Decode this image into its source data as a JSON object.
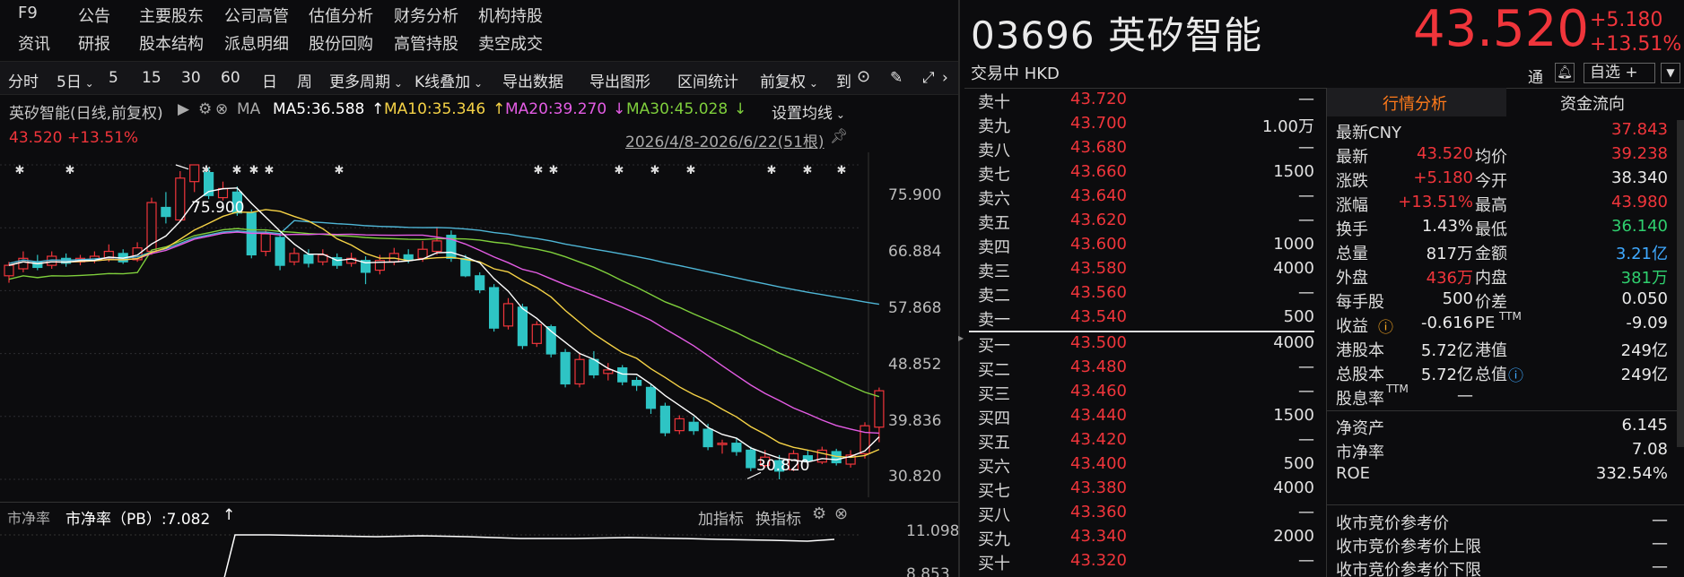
{
  "top_menu": {
    "row1": [
      "F9",
      "公告",
      "主要股东",
      "公司高管",
      "估值分析",
      "财务分析",
      "机构持股"
    ],
    "row2": [
      "资讯",
      "研报",
      "股本结构",
      "派息明细",
      "股份回购",
      "高管持股",
      "卖空成交"
    ]
  },
  "toolbar": {
    "items": [
      "分时",
      "5日",
      "5",
      "15",
      "30",
      "60",
      "日",
      "周",
      "更多周期",
      "K线叠加",
      "导出数据",
      "导出图形",
      "区间统计",
      "前复权",
      "到"
    ],
    "active": "日"
  },
  "ma_row": {
    "title": "英矽智能(日线,前复权)",
    "ma_label": "MA",
    "ma5": "MA5:36.588",
    "ma10": "MA10:35.346",
    "ma20": "MA20:39.270",
    "ma30": "MA30:45.028",
    "settings": "设置均线",
    "price": "43.520",
    "change_pct": "+13.51%",
    "range": "2026/4/8-2026/6/22(51根)"
  },
  "chart": {
    "y_ticks": [
      "75.900",
      "66.884",
      "57.868",
      "48.852",
      "39.836",
      "30.820"
    ],
    "high_label": "75.900",
    "low_label": "30.820",
    "colors": {
      "up": "#f0353b",
      "down": "#2ec4c4",
      "ma5": "#ffffff",
      "ma10": "#f5d246",
      "ma20": "#e45ce4",
      "ma30": "#7fcf3c",
      "ma60": "#4fb6d6"
    }
  },
  "sub_chart": {
    "name": "市净率",
    "label": "市净率（PB）:7.082",
    "add_indicator": "加指标",
    "swap_indicator": "换指标",
    "top_tick": "11.098",
    "bottom_tick": "8.853"
  },
  "quote": {
    "code_name": "03696 英矽智能",
    "status": "交易中 HKD",
    "price": "43.520",
    "change": "+5.180",
    "change_pct": "+13.51%",
    "tong": "通",
    "select": "自选 +"
  },
  "orderbook": {
    "asks": [
      {
        "label": "卖十",
        "price": "43.720",
        "vol": "—"
      },
      {
        "label": "卖九",
        "price": "43.700",
        "vol": "1.00万"
      },
      {
        "label": "卖八",
        "price": "43.680",
        "vol": "—"
      },
      {
        "label": "卖七",
        "price": "43.660",
        "vol": "1500"
      },
      {
        "label": "卖六",
        "price": "43.640",
        "vol": "—"
      },
      {
        "label": "卖五",
        "price": "43.620",
        "vol": "—"
      },
      {
        "label": "卖四",
        "price": "43.600",
        "vol": "1000"
      },
      {
        "label": "卖三",
        "price": "43.580",
        "vol": "4000"
      },
      {
        "label": "卖二",
        "price": "43.560",
        "vol": "—"
      },
      {
        "label": "卖一",
        "price": "43.540",
        "vol": "500"
      }
    ],
    "bids": [
      {
        "label": "买一",
        "price": "43.500",
        "vol": "4000"
      },
      {
        "label": "买二",
        "price": "43.480",
        "vol": "—"
      },
      {
        "label": "买三",
        "price": "43.460",
        "vol": "—"
      },
      {
        "label": "买四",
        "price": "43.440",
        "vol": "1500"
      },
      {
        "label": "买五",
        "price": "43.420",
        "vol": "—"
      },
      {
        "label": "买六",
        "price": "43.400",
        "vol": "500"
      },
      {
        "label": "买七",
        "price": "43.380",
        "vol": "4000"
      },
      {
        "label": "买八",
        "price": "43.360",
        "vol": "—"
      },
      {
        "label": "买九",
        "price": "43.340",
        "vol": "2000"
      },
      {
        "label": "买十",
        "price": "43.320",
        "vol": "—"
      }
    ]
  },
  "stats": {
    "tabs": [
      "行情分析",
      "资金流向"
    ],
    "latest_cny_label": "最新CNY",
    "latest_cny": "37.843",
    "rows": [
      {
        "l1": "最新",
        "v1": "43.520",
        "c1": "red",
        "l2": "均价",
        "v2": "39.238",
        "c2": "red"
      },
      {
        "l1": "涨跌",
        "v1": "+5.180",
        "c1": "red",
        "l2": "今开",
        "v2": "38.340",
        "c2": "white"
      },
      {
        "l1": "涨幅",
        "v1": "+13.51%",
        "c1": "red",
        "l2": "最高",
        "v2": "43.980",
        "c2": "red"
      },
      {
        "l1": "换手",
        "v1": "1.43%",
        "c1": "white",
        "l2": "最低",
        "v2": "36.140",
        "c2": "green"
      },
      {
        "l1": "总量",
        "v1": "817万",
        "c1": "white",
        "l2": "金额",
        "v2": "3.21亿",
        "c2": "cyan"
      },
      {
        "l1": "外盘",
        "v1": "436万",
        "c1": "red",
        "l2": "内盘",
        "v2": "381万",
        "c2": "green"
      },
      {
        "l1": "每手股",
        "v1": "500",
        "c1": "white",
        "l2": "价差",
        "v2": "0.050",
        "c2": "white"
      },
      {
        "l1": "收益",
        "v1": "-0.616",
        "c1": "white",
        "l2": "PE",
        "v2": "-9.09",
        "c2": "white"
      },
      {
        "l1": "港股本",
        "v1": "5.72亿",
        "c1": "white",
        "l2": "港值",
        "v2": "249亿",
        "c2": "white"
      },
      {
        "l1": "总股本",
        "v1": "5.72亿",
        "c1": "white",
        "l2": "总值",
        "v2": "249亿",
        "c2": "white"
      },
      {
        "l1": "股息率",
        "v1": "—",
        "c1": "white",
        "l2": "",
        "v2": "",
        "c2": "white"
      }
    ],
    "pe_sup": "TTM",
    "div_sup": "TTM",
    "extra": [
      {
        "label": "净资产",
        "value": "6.145"
      },
      {
        "label": "市净率",
        "value": "7.08"
      },
      {
        "label": "ROE",
        "value": "332.54%"
      }
    ],
    "auction": [
      {
        "label": "收市竞价参考价",
        "value": "—"
      },
      {
        "label": "收市竞价参考价上限",
        "value": "—"
      },
      {
        "label": "收市竞价参考价下限",
        "value": "—"
      }
    ]
  }
}
